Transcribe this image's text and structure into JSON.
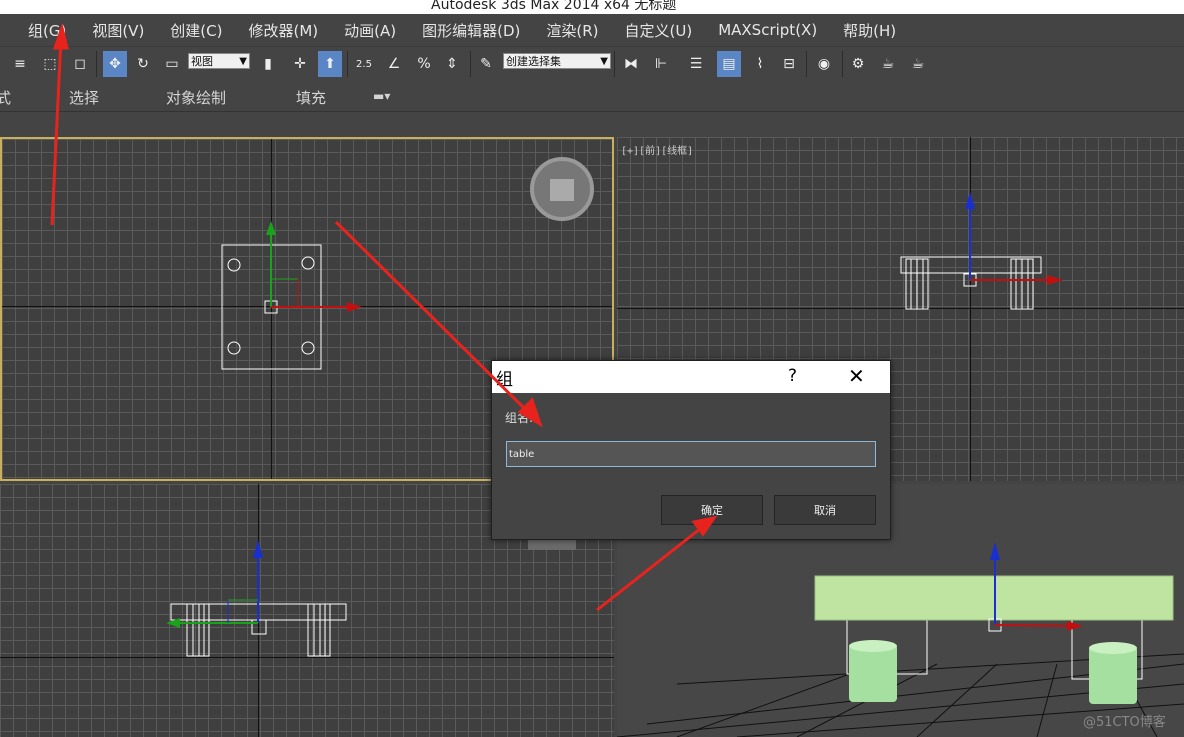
{
  "window": {
    "title": "Autodesk 3ds Max  2014 x64      无标题"
  },
  "menubar": {
    "items": [
      {
        "label": "组(G)"
      },
      {
        "label": "视图(V)"
      },
      {
        "label": "创建(C)"
      },
      {
        "label": "修改器(M)"
      },
      {
        "label": "动画(A)"
      },
      {
        "label": "图形编辑器(D)"
      },
      {
        "label": "渲染(R)"
      },
      {
        "label": "自定义(U)"
      },
      {
        "label": "MAXScript(X)"
      },
      {
        "label": "帮助(H)"
      }
    ]
  },
  "toolbar": {
    "coord_system_value": "视图",
    "selection_set_value": "创建选择集",
    "snap_angle_label": "2.5",
    "percent_snap_label": "%"
  },
  "ribbon": {
    "tabs": [
      {
        "label": "式"
      },
      {
        "label": "选择"
      },
      {
        "label": "对象绘制"
      },
      {
        "label": "填充"
      }
    ]
  },
  "viewports": {
    "front_label": "[+][前][线框]"
  },
  "dialog": {
    "title": "组",
    "help": "?",
    "close": "✕",
    "name_label": "组名:",
    "name_value": "table",
    "ok_label": "确定",
    "cancel_label": "取消"
  },
  "watermark": "@51CTO博客",
  "colors": {
    "active_viewport_border": "#c9b05f",
    "annotation_arrow": "#e8231d",
    "table_top_fill": "#bfe3a0",
    "leg_fill": "#a6e0a0",
    "toolbar_active": "#5b86c5"
  }
}
